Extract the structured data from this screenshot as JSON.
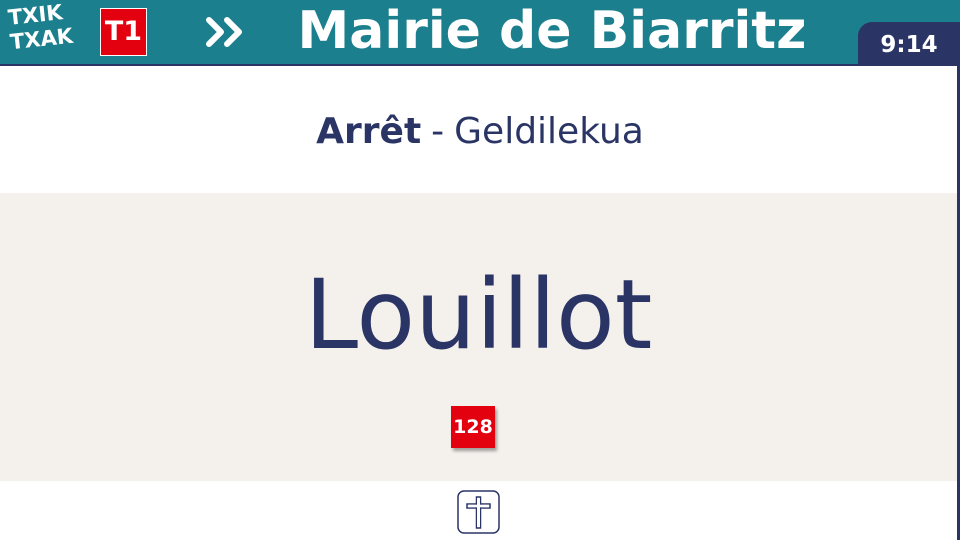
{
  "header": {
    "logo_line1": "TXIK",
    "logo_line2": "TXAK",
    "line_badge": "T1",
    "direction_icon": "double-chevron-right-icon",
    "destination": "Mairie de Biarritz",
    "clock": "9:14"
  },
  "stop": {
    "label_fr": "Arrêt",
    "separator": "-",
    "label_eu": "Geldilekua",
    "name": "Louillot",
    "connection_badge": "128",
    "poi_icon": "cemetery-cross-icon"
  },
  "colors": {
    "header_bg": "#1c7f8d",
    "navy": "#2a3566",
    "line_red": "#e3000f",
    "panel_bg": "#f4f1ec"
  }
}
